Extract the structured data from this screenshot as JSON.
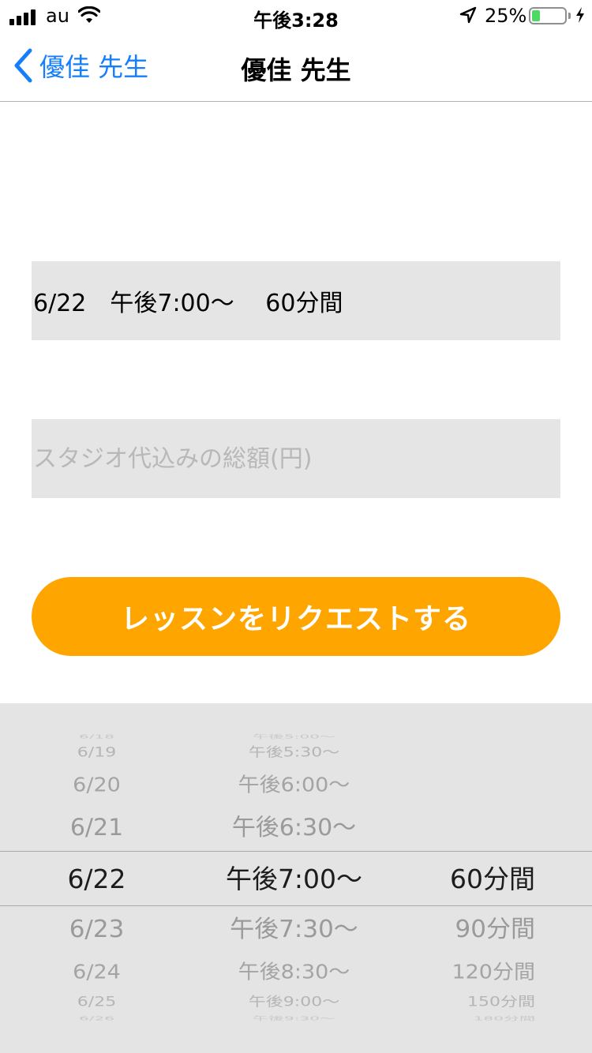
{
  "status_bar": {
    "carrier": "au",
    "time": "午後3:28",
    "battery_percent": "25%",
    "battery_level": 0.25,
    "icons": [
      "signal-icon",
      "wifi-icon",
      "location-icon",
      "battery-icon",
      "charging-icon"
    ]
  },
  "nav": {
    "back_label": "優佳 先生",
    "title": "優佳 先生"
  },
  "lesson": {
    "summary": "6/22　午後7:00〜　 60分間"
  },
  "price": {
    "placeholder": "スタジオ代込みの総額(円)",
    "value": ""
  },
  "request_button": {
    "label": "レッスンをリクエストする"
  },
  "picker": {
    "dates": [
      "6/18",
      "6/19",
      "6/20",
      "6/21",
      "6/22",
      "6/23",
      "6/24",
      "6/25",
      "6/26"
    ],
    "times": [
      "午後5:00〜",
      "午後5:30〜",
      "午後6:00〜",
      "午後6:30〜",
      "午後7:00〜",
      "午後7:30〜",
      "午後8:30〜",
      "午後9:00〜",
      "午後9:30〜"
    ],
    "durations": [
      "",
      "",
      "",
      "",
      "60分間",
      "90分間",
      "120分間",
      "150分間",
      "180分間"
    ],
    "selected_index": 4
  },
  "colors": {
    "accent": "#147efb",
    "button": "#ffa500",
    "field_bg": "#e5e5e5",
    "picker_bg": "#e4e4e4"
  }
}
